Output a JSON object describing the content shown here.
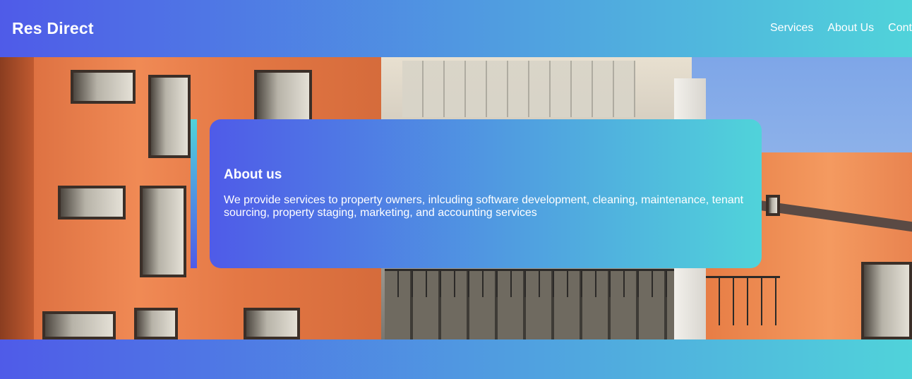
{
  "header": {
    "brand": "Res Direct",
    "nav": [
      {
        "label": "Services"
      },
      {
        "label": "About Us"
      },
      {
        "label": "Contact"
      }
    ]
  },
  "hero": {
    "image": "apartment-building-photo"
  },
  "about": {
    "title": "About us",
    "body": "We provide services to property owners, inlcuding software development, cleaning, maintenance, tenant sourcing, property staging, marketing, and accounting services"
  },
  "colors": {
    "gradient_start": "#4f5be8",
    "gradient_end": "#50d3da",
    "text": "#ffffff"
  }
}
